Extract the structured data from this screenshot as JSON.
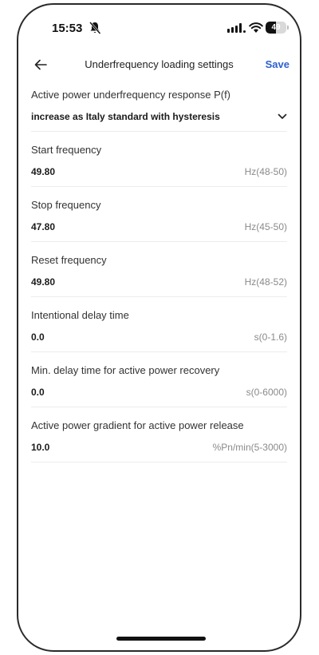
{
  "status": {
    "time": "15:53",
    "battery": "49",
    "battery_fraction": 0.49
  },
  "header": {
    "title": "Underfrequency loading settings",
    "save_label": "Save"
  },
  "fields": [
    {
      "label": "Active power underfrequency response P(f)",
      "value": "increase as Italy standard with hysteresis",
      "unit": "",
      "type": "dropdown"
    },
    {
      "label": "Start frequency",
      "value": "49.80",
      "unit": "Hz(48-50)",
      "type": "number"
    },
    {
      "label": "Stop frequency",
      "value": "47.80",
      "unit": "Hz(45-50)",
      "type": "number"
    },
    {
      "label": "Reset frequency",
      "value": "49.80",
      "unit": "Hz(48-52)",
      "type": "number"
    },
    {
      "label": "Intentional delay time",
      "value": "0.0",
      "unit": "s(0-1.6)",
      "type": "number"
    },
    {
      "label": "Min. delay time for active power recovery",
      "value": "0.0",
      "unit": "s(0-6000)",
      "type": "number"
    },
    {
      "label": "Active power gradient for active power release",
      "value": "10.0",
      "unit": "%Pn/min(5-3000)",
      "type": "number"
    }
  ],
  "icons": {
    "back": "arrow-left-icon",
    "dropdown": "chevron-down-icon",
    "silent": "bell-off-icon",
    "signal": "cellular-signal-icon",
    "wifi": "wifi-icon"
  },
  "colors": {
    "accent": "#2f5fd0",
    "unit_gray": "#8a8a8a"
  }
}
